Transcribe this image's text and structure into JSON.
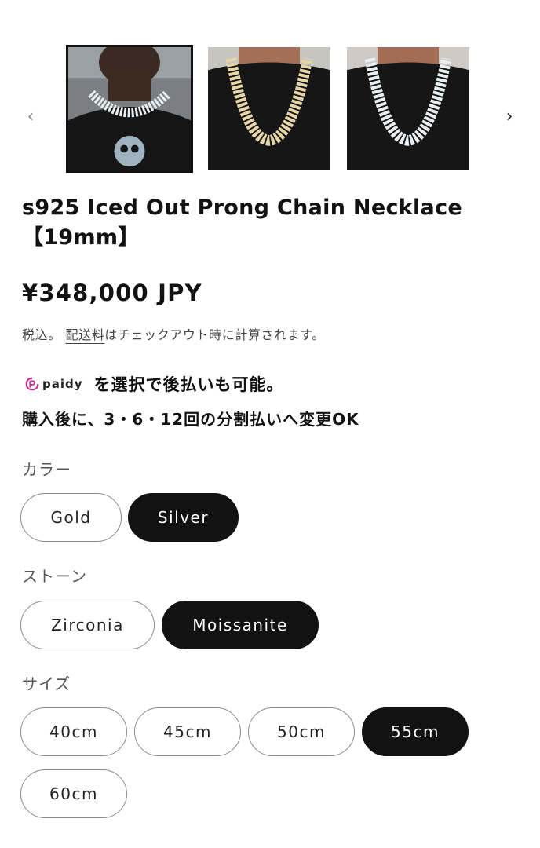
{
  "carousel": {
    "prev_icon": "chevron-left-icon",
    "next_icon": "chevron-right-icon",
    "prev_glyph": "‹",
    "next_glyph": "›",
    "images": [
      {
        "name": "product-image-1",
        "selected": true
      },
      {
        "name": "product-image-2",
        "selected": false
      },
      {
        "name": "product-image-3",
        "selected": false
      }
    ]
  },
  "product": {
    "title_line1": "s925 Iced Out Prong Chain Necklace",
    "title_line2": "【19mm】",
    "price": "¥348,000 JPY",
    "tax_prefix": "税込。",
    "shipping_link": "配送料",
    "tax_suffix": "はチェックアウト時に計算されます。"
  },
  "paidy": {
    "logo_text": "paidy",
    "message": "を選択で後払いも可能。",
    "installments": "購入後に、3・6・12回の分割払いへ変更OK",
    "brand_color": "#c52c8b"
  },
  "options": {
    "color": {
      "label": "カラー",
      "values": [
        "Gold",
        "Silver"
      ],
      "selected": "Silver"
    },
    "stone": {
      "label": "ストーン",
      "values": [
        "Zirconia",
        "Moissanite"
      ],
      "selected": "Moissanite"
    },
    "size": {
      "label": "サイズ",
      "values": [
        "40cm",
        "45cm",
        "50cm",
        "55cm",
        "60cm"
      ],
      "selected": "55cm"
    }
  }
}
